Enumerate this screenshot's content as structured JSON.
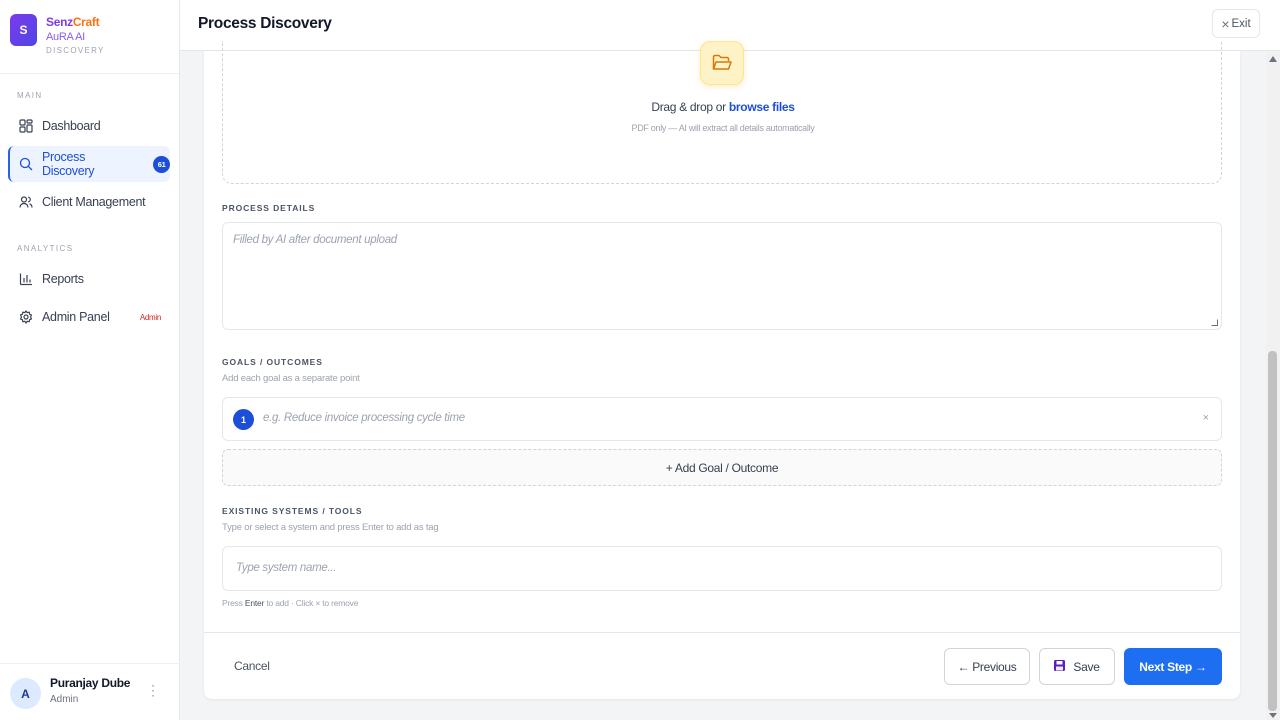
{
  "brand": {
    "logo_letter": "S",
    "name_part1": "Senz",
    "name_part2": "Craft",
    "product": "AuRA AI",
    "tagline": "DISCOVERY"
  },
  "sidebar": {
    "sections": [
      {
        "label": "MAIN"
      },
      {
        "label": "ANALYTICS"
      }
    ],
    "items": [
      {
        "label": "Dashboard",
        "icon": "grid-icon"
      },
      {
        "label": "Process Discovery",
        "icon": "search-icon",
        "badge": "61",
        "active": true
      },
      {
        "label": "Client Management",
        "icon": "users-icon"
      },
      {
        "label": "Reports",
        "icon": "bar-chart-icon"
      },
      {
        "label": "Admin Panel",
        "icon": "gear-icon",
        "badge": "Admin"
      }
    ]
  },
  "user": {
    "initial": "A",
    "name": "Puranjay Dube",
    "role": "Admin",
    "menu_glyph": "⋮"
  },
  "topbar": {
    "title": "Process Discovery",
    "exit_glyph": "×",
    "exit_label": "Exit"
  },
  "upload": {
    "text_prefix": "Drag & drop or ",
    "link": "browse files",
    "hint": "PDF only — AI will extract all details automatically"
  },
  "process_details": {
    "label": "PROCESS DETAILS",
    "placeholder": "Filled by AI after document upload"
  },
  "goals": {
    "label": "GOALS / OUTCOMES",
    "help": "Add each goal as a separate point",
    "items": [
      {
        "number": "1",
        "placeholder": "e.g. Reduce invoice processing cycle time",
        "remove_glyph": "×"
      }
    ],
    "add_label": "+ Add Goal / Outcome"
  },
  "systems": {
    "label": "EXISTING SYSTEMS / TOOLS",
    "help": "Type or select a system and press Enter to add as tag",
    "placeholder": "Type system name...",
    "hint_prefix": "Press ",
    "hint_key": "Enter",
    "hint_suffix": " to add · Click × to remove"
  },
  "footer": {
    "cancel": "Cancel",
    "previous": "← Previous",
    "save": "Save",
    "next": "Next Step →"
  },
  "colors": {
    "accent": "#1d6ef0",
    "active_bg": "#eef4ff",
    "brand_purple": "#7c3aed",
    "brand_orange": "#f97316",
    "admin_red": "#dc2626"
  }
}
